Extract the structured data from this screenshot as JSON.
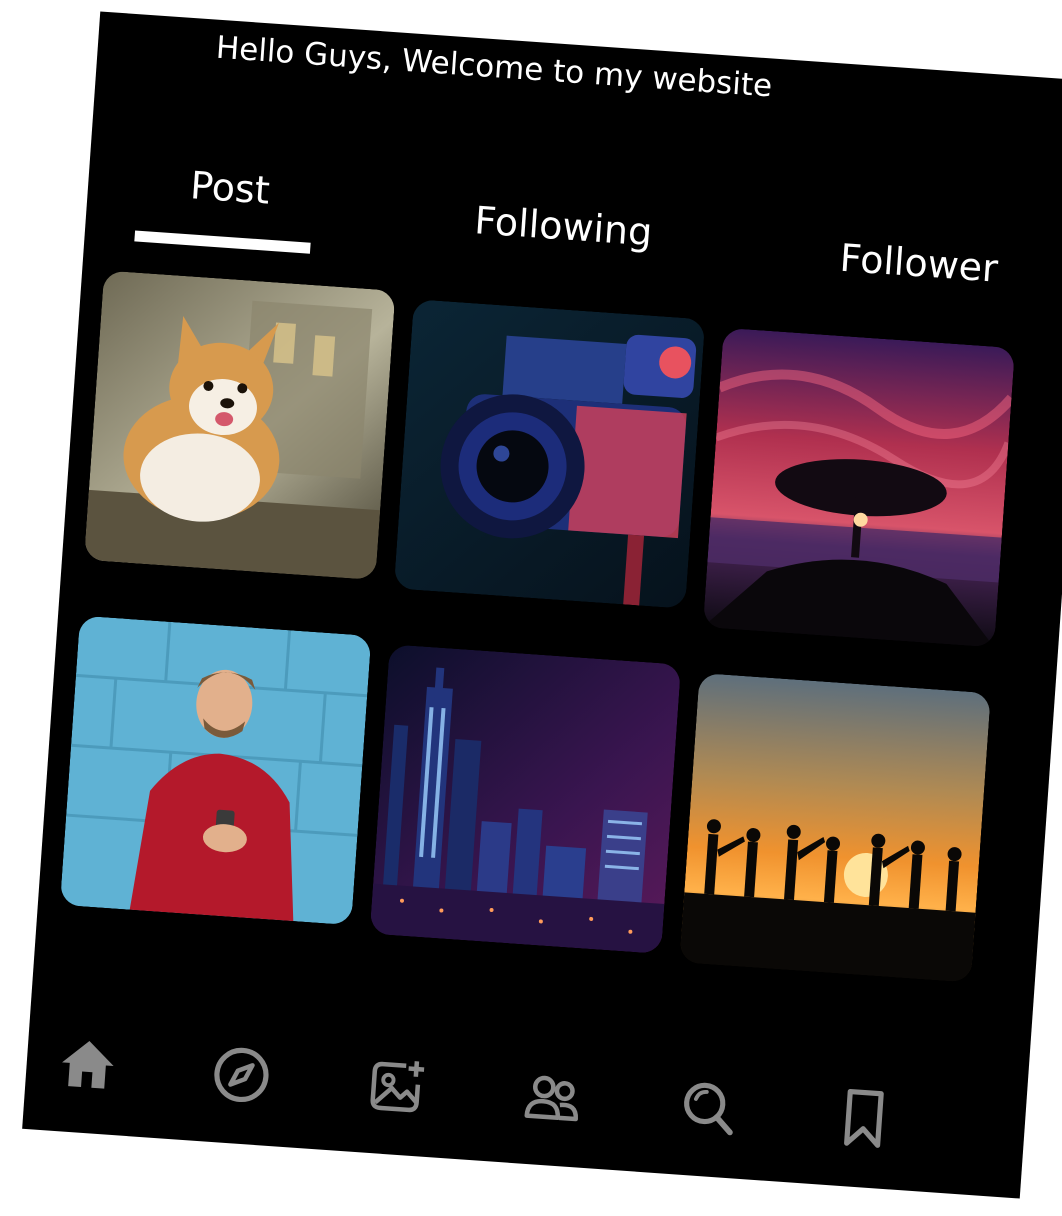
{
  "header": {
    "greeting": "Hello Guys, Welcome to my website"
  },
  "tabs": [
    {
      "label": "Post",
      "active": true
    },
    {
      "label": "Following",
      "active": false
    },
    {
      "label": "Follower",
      "active": false
    }
  ],
  "grid": {
    "images": [
      {
        "subject": "corgi-puppy"
      },
      {
        "subject": "video-camera"
      },
      {
        "subject": "tree-at-sunset"
      },
      {
        "subject": "man-with-headphones"
      },
      {
        "subject": "city-at-night"
      },
      {
        "subject": "silhouettes-at-sunset"
      }
    ]
  },
  "bottom_nav": {
    "icons": [
      "home-icon",
      "compass-icon",
      "add-photo-icon",
      "people-icon",
      "search-icon",
      "bookmark-icon"
    ],
    "active_color": "#8a8a8a",
    "inactive_color": "#8a8a8a"
  },
  "colors": {
    "background": "#000000",
    "text": "#ffffff"
  }
}
